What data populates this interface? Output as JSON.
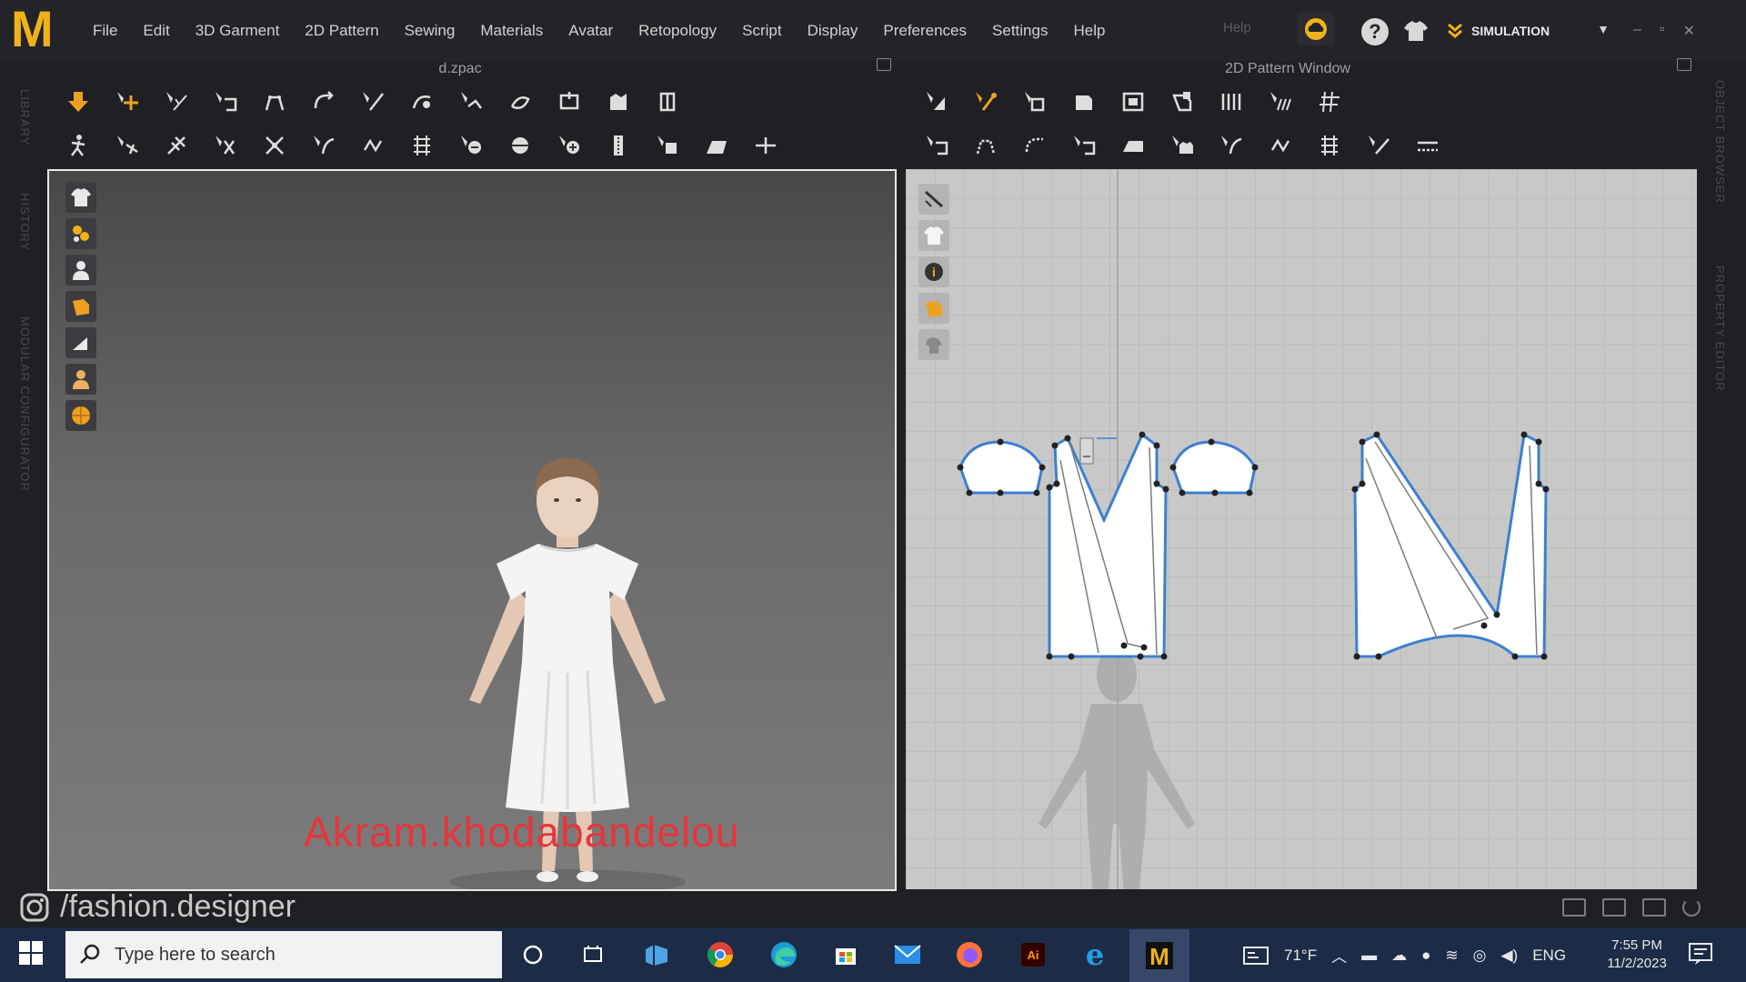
{
  "app": {
    "logo_letter": "M",
    "menu": [
      "File",
      "Edit",
      "3D Garment",
      "2D Pattern",
      "Sewing",
      "Materials",
      "Avatar",
      "Retopology",
      "Script",
      "Display",
      "Preferences",
      "Settings",
      "Help"
    ],
    "help_placeholder": "Help",
    "simulation_label": "SIMULATION",
    "window_controls": [
      "–",
      "▫",
      "✕"
    ]
  },
  "panels": {
    "left_title": "d.zpac",
    "right_title": "2D Pattern Window",
    "side_labels_left": [
      "LIBRARY",
      "HISTORY",
      "MODULAR CONFIGURATOR"
    ],
    "side_labels_right": [
      "OBJECT BROWSER",
      "PROPERTY EDITOR"
    ]
  },
  "overlay": {
    "watermark": "Akram.khodabandelou",
    "handle": "/fashion.designer"
  },
  "taskbar": {
    "search_placeholder": "Type here to search",
    "weather": "71°F",
    "language": "ENG",
    "time": "7:55 PM",
    "date": "11/2/2023"
  },
  "colors": {
    "accent": "#f0b21a",
    "pattern_outline": "#3d7fd1",
    "watermark": "#e5353b",
    "taskbar": "#1d2c46"
  }
}
